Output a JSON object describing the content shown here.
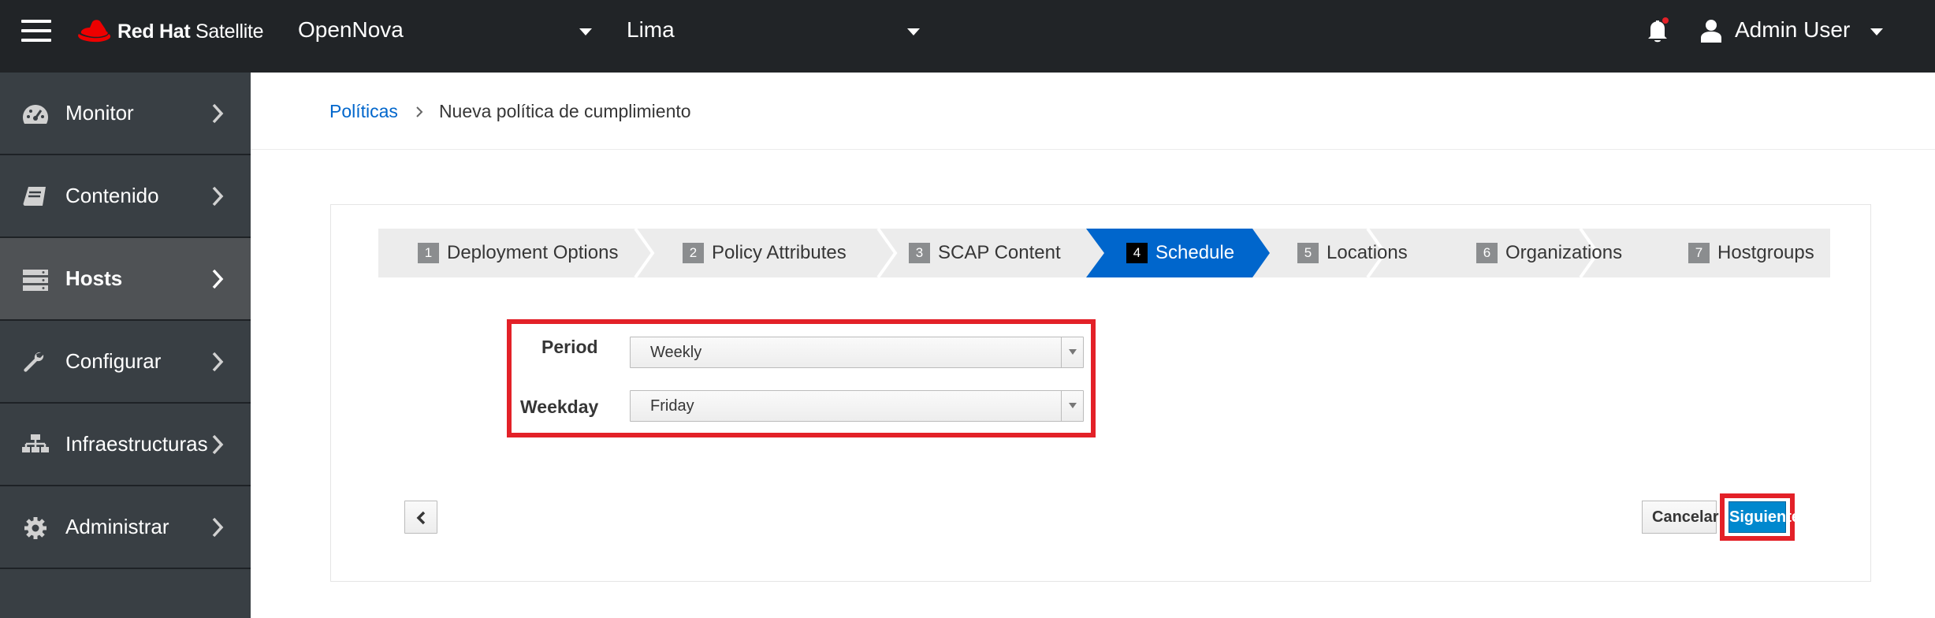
{
  "header": {
    "brand_bold": "Red Hat",
    "brand_rest": "Satellite",
    "organization": "OpenNova",
    "location": "Lima",
    "user": "Admin User",
    "icons": [
      "hamburger-icon",
      "redhat-logo",
      "bell-icon",
      "user-icon",
      "caret-down-icon"
    ]
  },
  "sidebar": {
    "items": [
      {
        "label": "Monitor",
        "icon": "dashboard-icon"
      },
      {
        "label": "Contenido",
        "icon": "book-icon"
      },
      {
        "label": "Hosts",
        "icon": "server-icon",
        "active": true
      },
      {
        "label": "Configurar",
        "icon": "wrench-icon"
      },
      {
        "label": "Infraestructuras",
        "icon": "sitemap-icon"
      },
      {
        "label": "Administrar",
        "icon": "gear-icon"
      }
    ]
  },
  "breadcrumb": {
    "parent": "Políticas",
    "current": "Nueva política de cumplimiento"
  },
  "wizard": {
    "steps": [
      {
        "num": "1",
        "label": "Deployment Options"
      },
      {
        "num": "2",
        "label": "Policy Attributes"
      },
      {
        "num": "3",
        "label": "SCAP Content"
      },
      {
        "num": "4",
        "label": "Schedule",
        "active": true
      },
      {
        "num": "5",
        "label": "Locations"
      },
      {
        "num": "6",
        "label": "Organizations"
      },
      {
        "num": "7",
        "label": "Hostgroups"
      }
    ]
  },
  "form": {
    "period_label": "Period",
    "period_value": "Weekly",
    "weekday_label": "Weekday",
    "weekday_value": "Friday"
  },
  "buttons": {
    "cancel": "Cancelar",
    "next": "Siguiente"
  },
  "colors": {
    "topbar": "#212427",
    "sidebar": "#393f44",
    "active_step": "#0066cc",
    "primary": "#0088ce",
    "highlight": "#e32128",
    "link": "#0066cc"
  }
}
